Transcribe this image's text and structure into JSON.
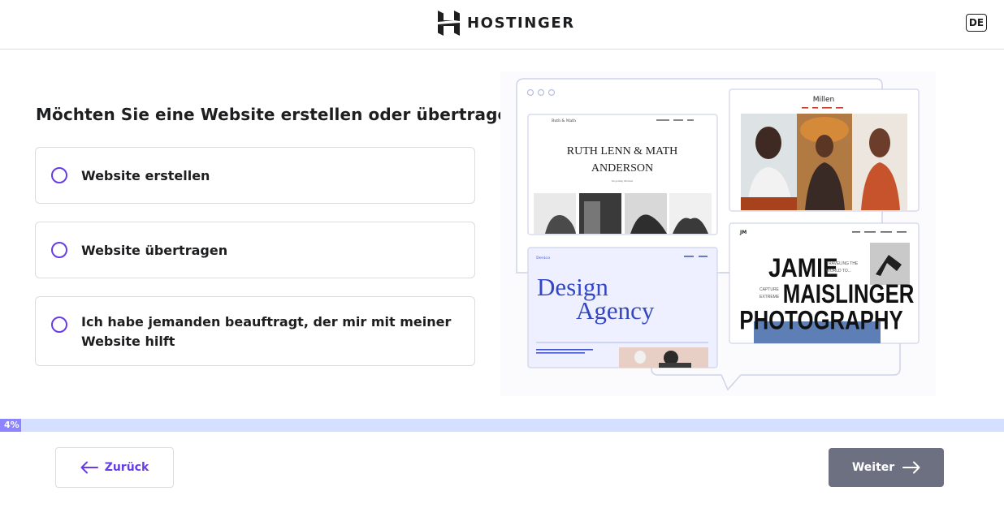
{
  "header": {
    "brand": "HOSTINGER",
    "language": "DE"
  },
  "question": "Möchten Sie eine Website erstellen oder übertragen?",
  "options": [
    {
      "label": "Website erstellen"
    },
    {
      "label": "Website übertragen"
    },
    {
      "label": "Ich habe jemanden beauftragt, der mir mit meiner Website hilft"
    }
  ],
  "illustration": {
    "card_ruth": {
      "nav_brand": "Ruth & Math",
      "title": "RUTH LENN & MATH ANDERSON",
      "subtitle": "Im getting Married"
    },
    "card_millen": {
      "title": "Millen"
    },
    "card_design": {
      "nav_brand": "Devico",
      "title_line1": "Design",
      "title_line2": "Agency"
    },
    "card_jamie": {
      "logo": "JM",
      "line1": "JAMIE",
      "line2": "MAISLINGER",
      "line3": "PHOTOGRAPHY",
      "tag1": "TRAVELING THE WORLD TO...",
      "tag2": "CAPTURE EXTREME"
    }
  },
  "progress": {
    "percent_label": "4%",
    "value": 0.04
  },
  "footer": {
    "back_label": "Zurück",
    "next_label": "Weiter"
  },
  "colors": {
    "accent": "#673de6",
    "progress_track": "#d5dfff",
    "progress_fill": "#8c85ff",
    "next_button": "#6d7081"
  }
}
